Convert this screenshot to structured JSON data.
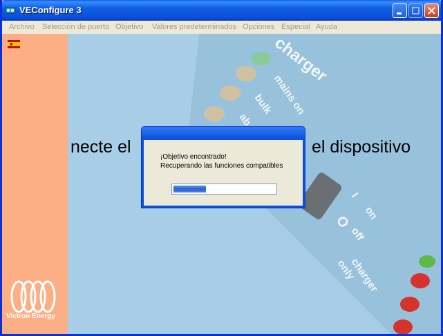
{
  "window": {
    "title": "VEConfigure 3"
  },
  "menu": [
    "Archivo",
    "Selección de puerto",
    "Objetivo",
    "Valores predeterminados",
    "Opciones",
    "Especial",
    "Ayuda"
  ],
  "sidebar": {
    "logo_text": "Victron Energy"
  },
  "background": {
    "left_text": "necte el",
    "right_text": "el dispositivo",
    "art_labels": [
      "charger",
      "mains on",
      "bulk",
      "ab",
      "I",
      "on",
      "O",
      "off",
      "charger",
      "only"
    ]
  },
  "dialog": {
    "line1": "¡Objetivo encontrado!",
    "line2": "Recuperando las funciones compatibles",
    "progress": 0.32
  }
}
